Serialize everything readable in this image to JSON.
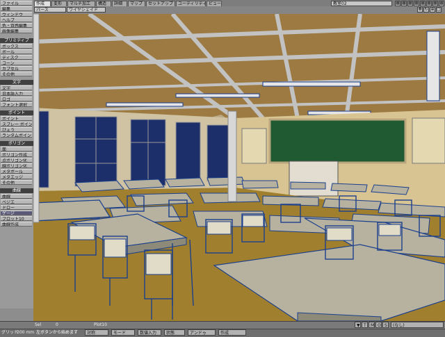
{
  "sidebar": {
    "file_menu": "ファイル",
    "edit_menu": "編集",
    "window_menu": "ウィンドウ",
    "help_menu": "ヘルプ",
    "color_edit": "色・質感編集",
    "image_edit": "画像編集",
    "primitive_header": "プリミティブ",
    "primitive_items": [
      "ボックス",
      "ボール",
      "ディスク",
      "コーン",
      "カプセル",
      "その他"
    ],
    "text_header": "文字",
    "text_items": [
      "文字",
      "日本語入力",
      "ロゴ",
      "フォント選択"
    ],
    "point_header": "ポイント",
    "point_items": [
      "ポイント",
      "スプレー ポイント",
      "びょう",
      "ランダムポイント"
    ],
    "polygon_header": "ポリゴン",
    "polygon_items": [
      "面",
      "ポリゴン作成",
      "点ポリゴン化",
      "線ポリゴン化",
      "メタボール",
      "メタエッジ",
      "その他"
    ],
    "curve_header": "曲線",
    "curve_items": [
      "曲線",
      "ベジエ",
      "ドロー",
      "ゲージ",
      "ブロット10",
      "曲線作成"
    ]
  },
  "tabs": [
    "作成",
    "変形",
    "マルチ加工",
    "構造",
    "詳細",
    "マップ",
    "セットアップ",
    "ユーティリティ",
    "ビュー"
  ],
  "active_tab": 0,
  "scene_name": "教室02",
  "view_mode": "パース",
  "shading_mode": "ワイヤシェイド",
  "bottom": {
    "sel_label": "Sel",
    "sel_value": "0",
    "plot_label": "Plot10",
    "grid_label": "グリッド",
    "grid_value": "200 mm",
    "hint": "左ボタンから始めます",
    "buttons": [
      "対称",
      "モード",
      "数値入力",
      "状態",
      "アンドゥ",
      "作成"
    ],
    "layer_buttons": [
      "T",
      "M",
      "O",
      "S"
    ],
    "none_label": "(なし)"
  },
  "colors": {
    "ceiling": "#9c7a42",
    "beam": "#bcbcbc",
    "floor": "#a0802e",
    "wall": "#d8c493",
    "blackboard": "#1f5a32",
    "desk": "#b7b2a0",
    "wire": "#1a3f8c"
  }
}
